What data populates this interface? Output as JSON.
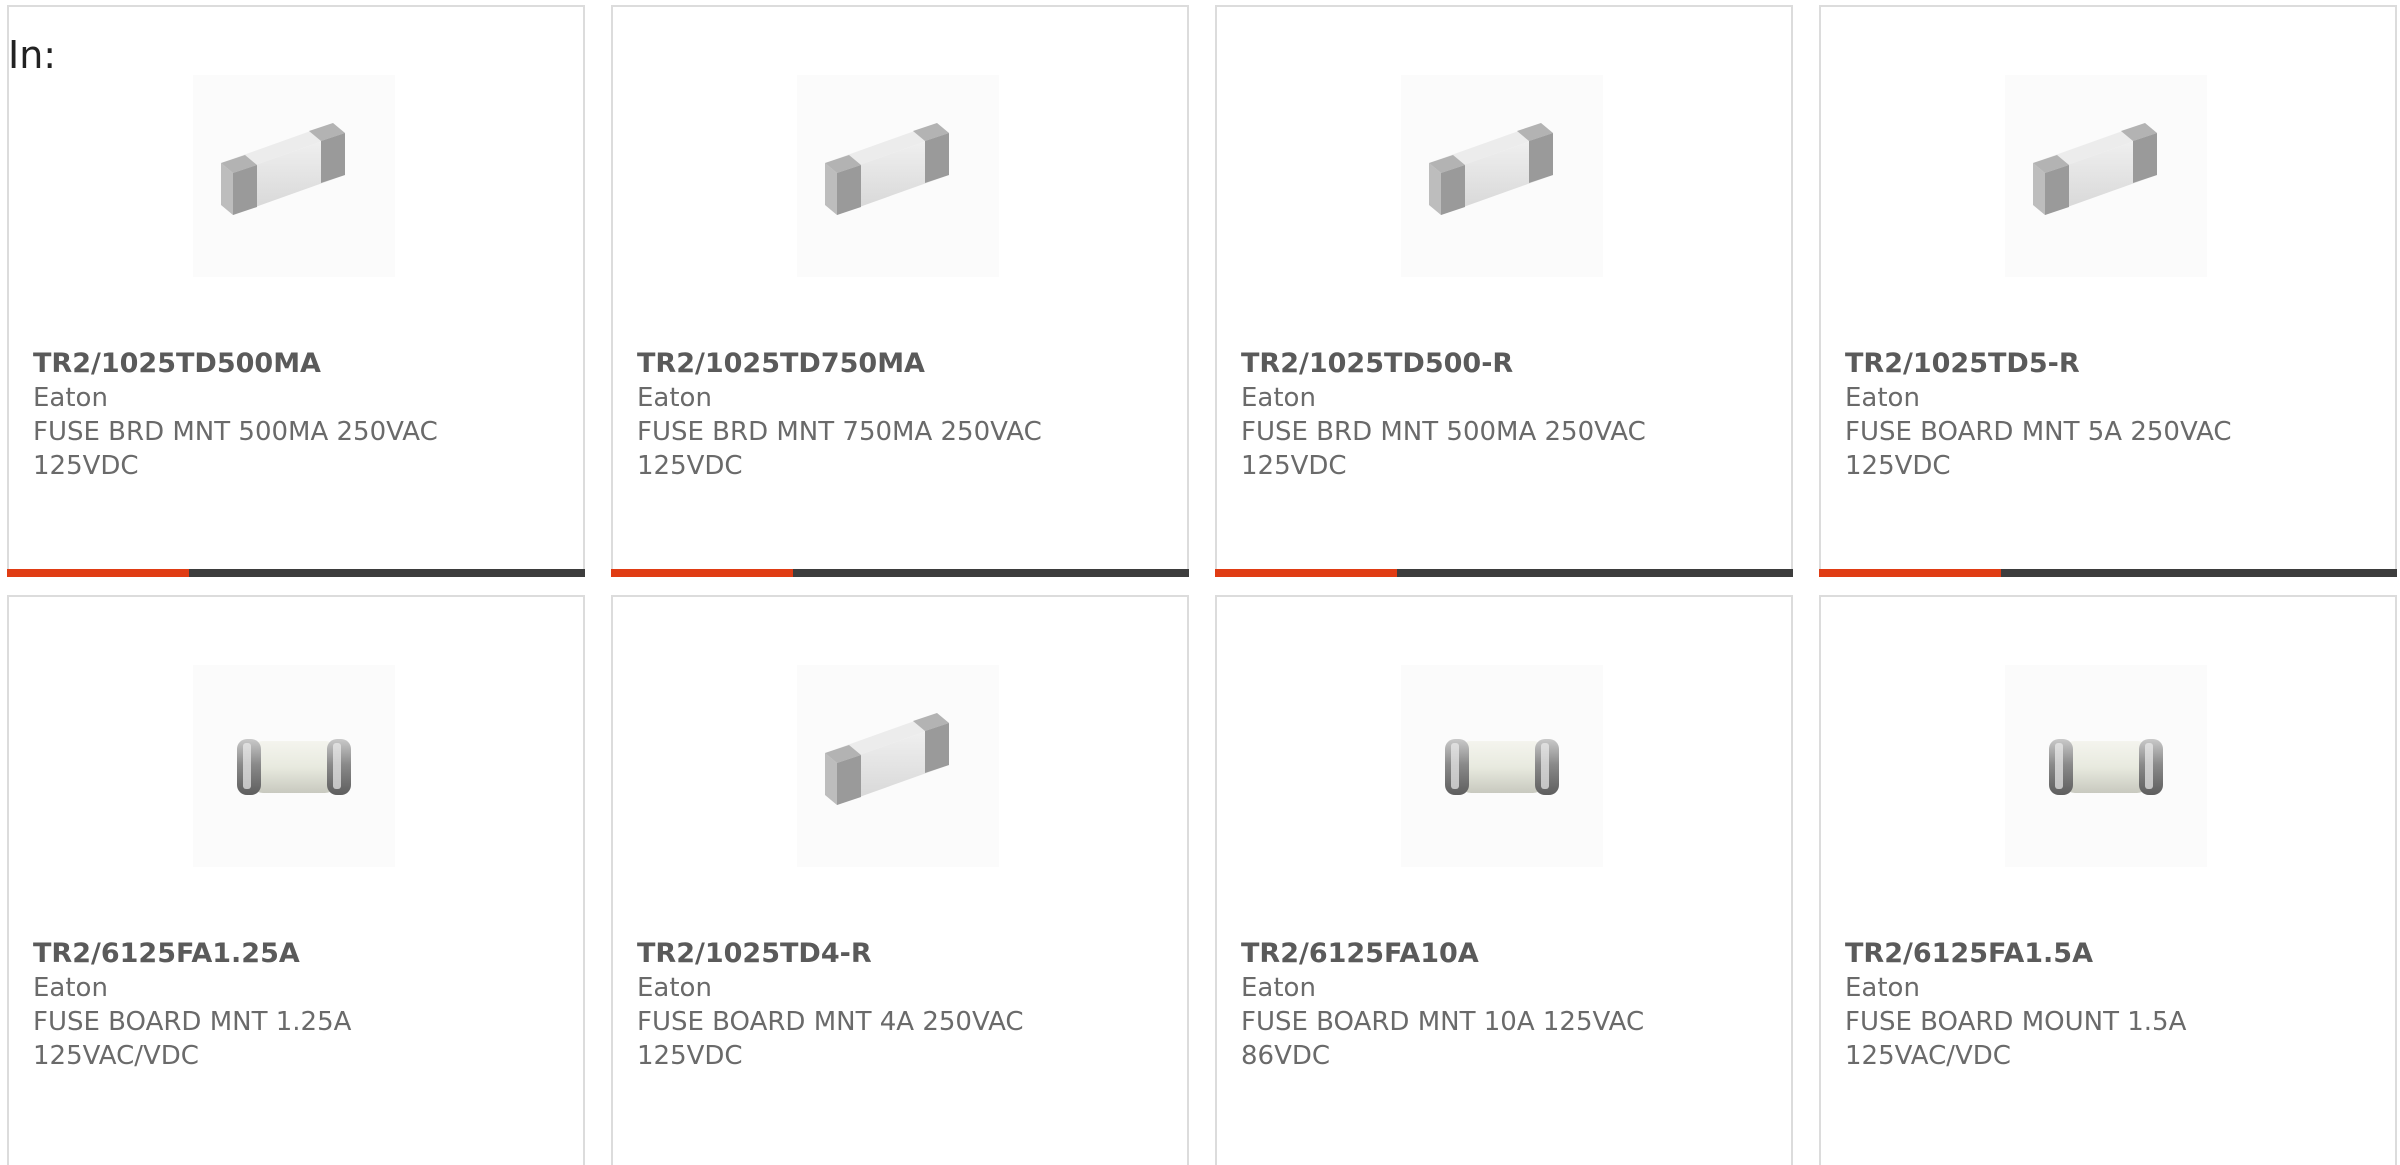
{
  "header": {
    "label": "In:"
  },
  "colors": {
    "accent": "#e03c14",
    "bar": "#3d3d3d",
    "border": "#dcdcdc"
  },
  "products": [
    {
      "part": "TR2/1025TD500MA",
      "brand": "Eaton",
      "desc1": "FUSE BRD MNT 500MA 250VAC",
      "desc2": "125VDC",
      "image_icon": "rect-fuse-icon"
    },
    {
      "part": "TR2/1025TD750MA",
      "brand": "Eaton",
      "desc1": "FUSE BRD MNT 750MA 250VAC",
      "desc2": "125VDC",
      "image_icon": "rect-fuse-icon"
    },
    {
      "part": "TR2/1025TD500-R",
      "brand": "Eaton",
      "desc1": "FUSE BRD MNT 500MA 250VAC",
      "desc2": "125VDC",
      "image_icon": "rect-fuse-icon"
    },
    {
      "part": "TR2/1025TD5-R",
      "brand": "Eaton",
      "desc1": "FUSE BOARD MNT 5A 250VAC",
      "desc2": "125VDC",
      "image_icon": "rect-fuse-icon"
    },
    {
      "part": "TR2/6125FA1.25A",
      "brand": "Eaton",
      "desc1": "FUSE BOARD MNT 1.25A",
      "desc2": "125VAC/VDC",
      "image_icon": "cylinder-fuse-icon"
    },
    {
      "part": "TR2/1025TD4-R",
      "brand": "Eaton",
      "desc1": "FUSE BOARD MNT 4A 250VAC",
      "desc2": "125VDC",
      "image_icon": "rect-fuse-icon"
    },
    {
      "part": "TR2/6125FA10A",
      "brand": "Eaton",
      "desc1": "FUSE BOARD MNT 10A 125VAC",
      "desc2": "86VDC",
      "image_icon": "cylinder-fuse-icon"
    },
    {
      "part": "TR2/6125FA1.5A",
      "brand": "Eaton",
      "desc1": "FUSE BOARD MOUNT 1.5A",
      "desc2": "125VAC/VDC",
      "image_icon": "cylinder-fuse-icon"
    }
  ]
}
